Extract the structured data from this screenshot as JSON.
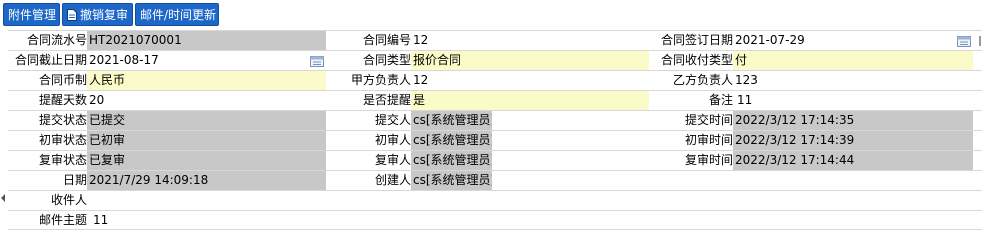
{
  "toolbar": {
    "attach_label": "附件管理",
    "revoke_label": "撤销复审",
    "mail_label": "邮件/时间更新"
  },
  "rows": {
    "r1": {
      "l1": "合同流水号",
      "v1": "HT2021070001",
      "l2": "合同编号",
      "v2": "12",
      "l3": "合同签订日期",
      "v3": "2021-07-29"
    },
    "r2": {
      "l1": "合同截止日期",
      "v1": "2021-08-17",
      "l2": "合同类型",
      "v2": "报价合同",
      "l3": "合同收付类型",
      "v3": "付"
    },
    "r3": {
      "l1": "合同币制",
      "v1": "人民币",
      "l2": "甲方负责人",
      "v2": "12",
      "l3": "乙方负责人",
      "v3": "123"
    },
    "r4": {
      "l1": "提醒天数",
      "v1": "20",
      "l2": "是否提醒",
      "v2": "是",
      "l3": "备注",
      "v3": "11"
    },
    "r5": {
      "l1": "提交状态",
      "v1": "已提交",
      "l2": "提交人",
      "v2": "cs[系统管理员]",
      "l3": "提交时间",
      "v3": "2022/3/12 17:14:35"
    },
    "r6": {
      "l1": "初审状态",
      "v1": "已初审",
      "l2": "初审人",
      "v2": "cs[系统管理员]",
      "l3": "初审时间",
      "v3": "2022/3/12 17:14:39"
    },
    "r7": {
      "l1": "复审状态",
      "v1": "已复审",
      "l2": "复审人",
      "v2": "cs[系统管理员]",
      "l3": "复审时间",
      "v3": "2022/3/12 17:14:44"
    },
    "r8": {
      "l1": "日期",
      "v1": "2021/7/29 14:09:18",
      "l2": "创建人",
      "v2": "cs[系统管理员]"
    },
    "r9": {
      "l1": "收件人",
      "v1": ""
    },
    "r10": {
      "l1": "邮件主题",
      "v1": "11"
    }
  },
  "colors": {
    "button_blue": "#1d67c9",
    "readonly_gray": "#c8c8c8",
    "required_yellow": "#fbfbc9"
  },
  "icons": {
    "calendar": "calendar-icon",
    "document": "document-icon",
    "collapse": "collapse-arrow-icon"
  }
}
